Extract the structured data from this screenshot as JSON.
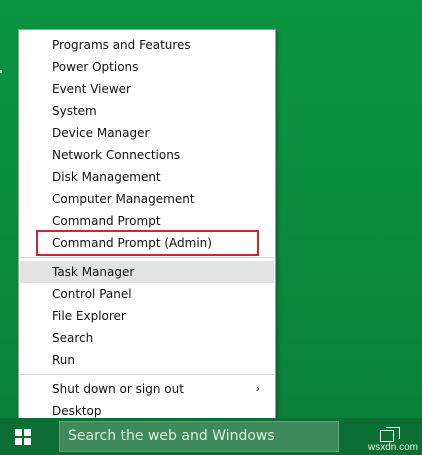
{
  "menu": {
    "items": [
      {
        "label": "Programs and Features"
      },
      {
        "label": "Power Options"
      },
      {
        "label": "Event Viewer"
      },
      {
        "label": "System"
      },
      {
        "label": "Device Manager"
      },
      {
        "label": "Network Connections"
      },
      {
        "label": "Disk Management"
      },
      {
        "label": "Computer Management"
      },
      {
        "label": "Command Prompt"
      },
      {
        "label": "Command Prompt (Admin)"
      },
      {
        "label": "Task Manager"
      },
      {
        "label": "Control Panel"
      },
      {
        "label": "File Explorer"
      },
      {
        "label": "Search"
      },
      {
        "label": "Run"
      },
      {
        "label": "Shut down or sign out"
      },
      {
        "label": "Desktop"
      }
    ],
    "submenu_chevron": "›",
    "highlight_color": "#d1272a"
  },
  "taskbar": {
    "search_placeholder": "Search the web and Windows",
    "start_icon": "windows-logo-icon",
    "taskview_icon": "task-view-icon"
  },
  "watermark": "wsxdn.com"
}
